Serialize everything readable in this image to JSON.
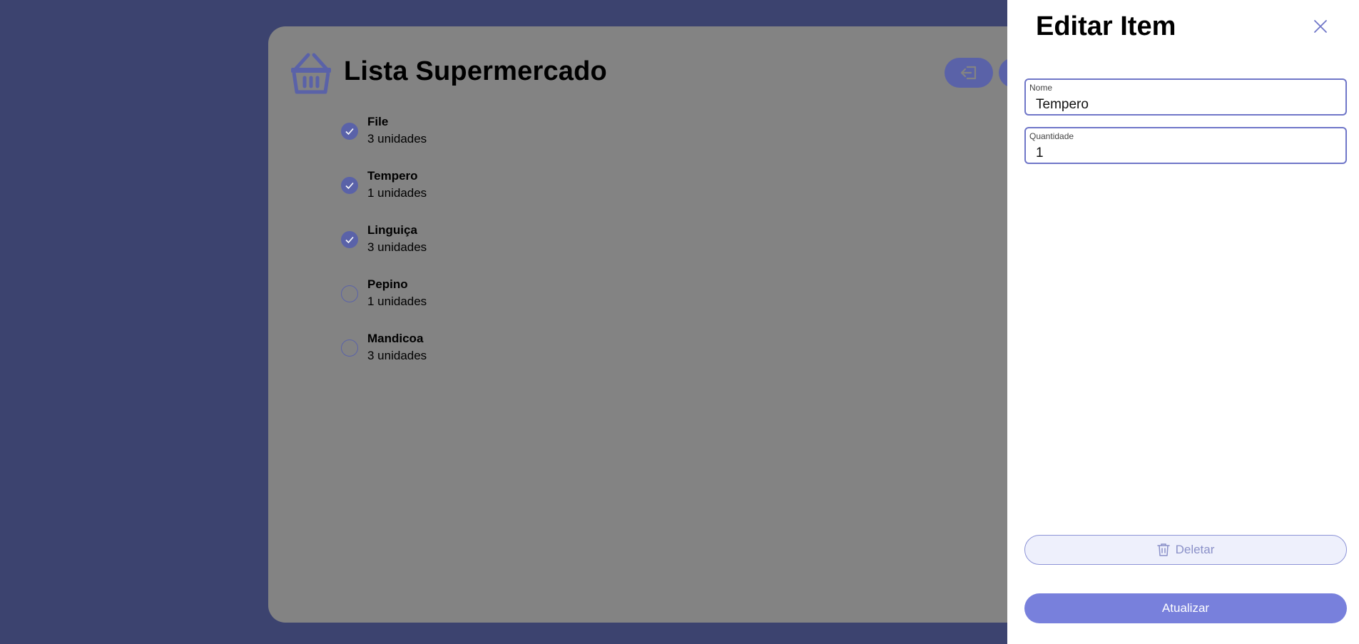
{
  "app": {
    "title": "Lista Supermercado",
    "icon": "shopping-basket-icon",
    "accent_color": "#5a62a8"
  },
  "toolbar": {
    "buttons": [
      {
        "icon": "logout-icon"
      },
      {
        "icon": "unknown-icon"
      }
    ]
  },
  "list": {
    "items": [
      {
        "name": "File",
        "quantity": "3 unidades",
        "checked": true
      },
      {
        "name": "Tempero",
        "quantity": "1 unidades",
        "checked": true
      },
      {
        "name": "Linguiça",
        "quantity": "3 unidades",
        "checked": true
      },
      {
        "name": "Pepino",
        "quantity": "1 unidades",
        "checked": false
      },
      {
        "name": "Mandicoa",
        "quantity": "3 unidades",
        "checked": false
      }
    ]
  },
  "edit_panel": {
    "title": "Editar Item",
    "close_icon": "close-icon",
    "name_field": {
      "label": "Nome",
      "value": "Tempero"
    },
    "quantity_field": {
      "label": "Quantidade",
      "value": "1"
    },
    "delete_button": {
      "label": "Deletar",
      "icon": "trash-icon"
    },
    "update_button": {
      "label": "Atualizar",
      "color": "#7880dc"
    }
  }
}
